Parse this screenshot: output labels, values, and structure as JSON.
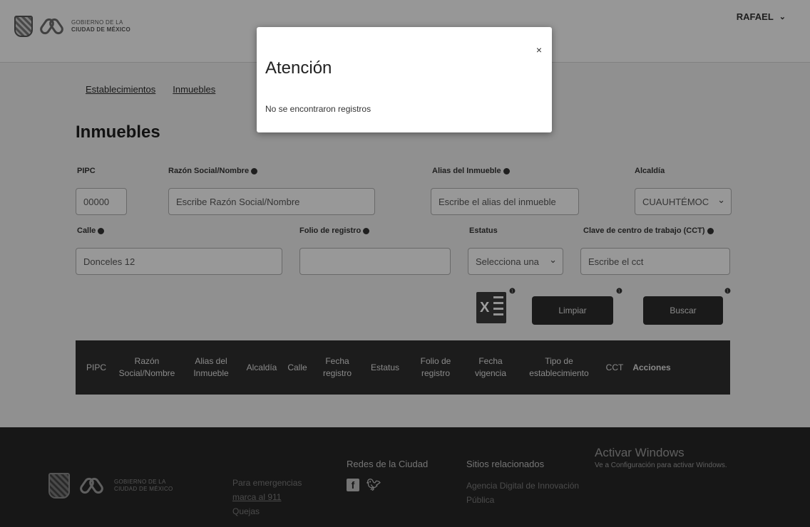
{
  "header": {
    "logo_line1": "GOBIERNO DE LA",
    "logo_line2": "CIUDAD DE MÉXICO",
    "user_name": "RAFAEL"
  },
  "tabs": [
    {
      "label": "Establecimientos"
    },
    {
      "label": "Inmuebles"
    }
  ],
  "page_title": "Inmuebles",
  "form": {
    "pipc": {
      "label": "PIPC",
      "value": "00000"
    },
    "razon": {
      "label": "Razón Social/Nombre",
      "placeholder": "Escribe Razón Social/Nombre"
    },
    "alias": {
      "label": "Alias del Inmueble",
      "placeholder": "Escribe el alias del inmueble"
    },
    "alcaldia": {
      "label": "Alcaldía",
      "value": "CUAUHTÉMOC"
    },
    "calle": {
      "label": "Calle",
      "value": "Donceles 12"
    },
    "folio": {
      "label": "Folio de registro",
      "placeholder": ""
    },
    "estatus": {
      "label": "Estatus",
      "value": "Selecciona una"
    },
    "cct": {
      "label": "Clave de centro de trabajo (CCT)",
      "placeholder": "Escribe el cct"
    }
  },
  "buttons": {
    "excel_label": "X",
    "limpiar": "Limpiar",
    "buscar": "Buscar"
  },
  "table": {
    "columns": [
      "PIPC",
      "Razón Social/Nombre",
      "Alias del Inmueble",
      "Alcaldía",
      "Calle",
      "Fecha registro",
      "Estatus",
      "Folio de registro",
      "Fecha vigencia",
      "Tipo de establecimiento",
      "CCT",
      "Acciones"
    ]
  },
  "footer": {
    "logo_line1": "GOBIERNO DE LA",
    "logo_line2": "CIUDAD DE MÉXICO",
    "emergency_line1": "Para emergencias",
    "emergency_line2": "marca al 911",
    "emergency_line3": "Quejas",
    "social_title": "Redes de la Ciudad",
    "related_title": "Sitios relacionados",
    "related_link1": "Agencia Digital de Innovación",
    "related_link2": "Pública",
    "windows_title": "Activar Windows",
    "windows_sub": "Ve a Configuración para activar Windows."
  },
  "modal": {
    "title": "Atención",
    "close": "×",
    "message": "No se encontraron registros"
  }
}
